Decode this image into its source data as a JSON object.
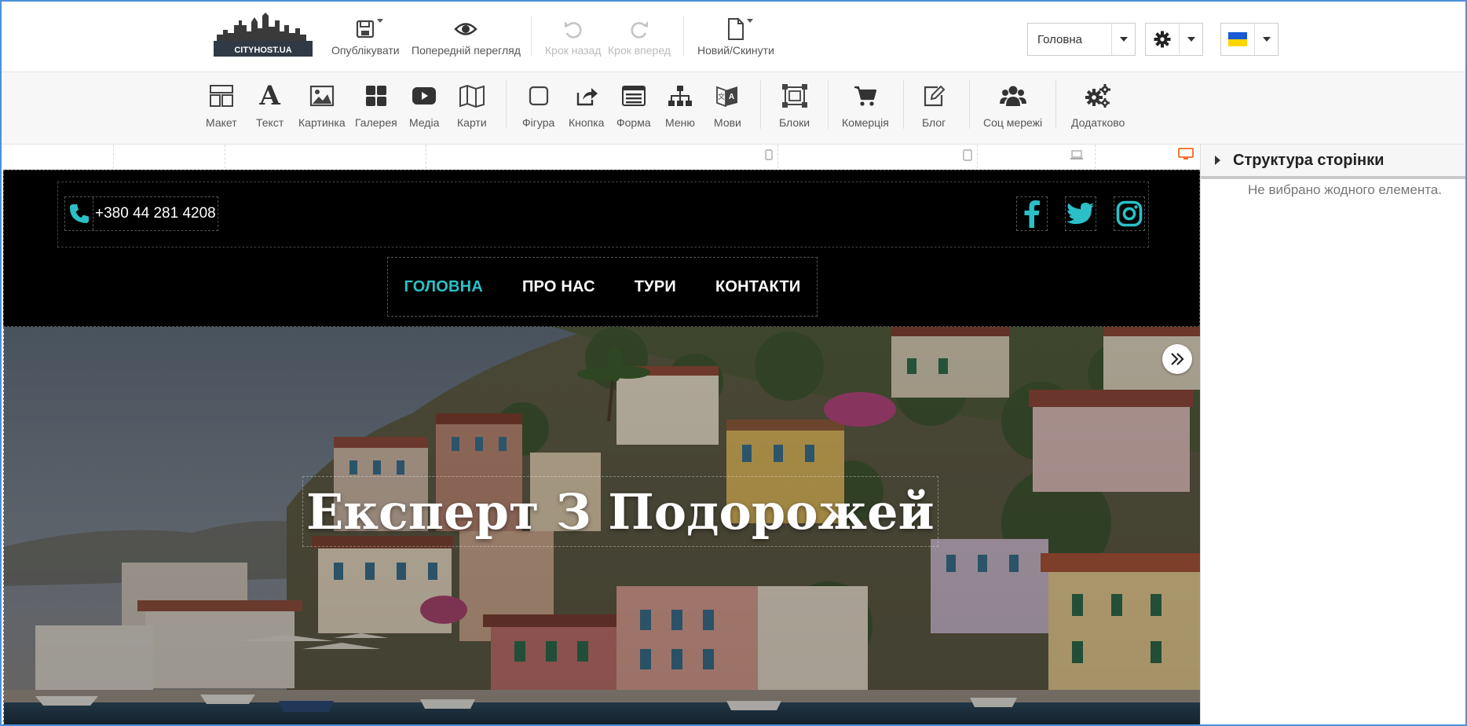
{
  "topbar": {
    "logo_text": "CITYHOST.UA",
    "publish": "Опублікувати",
    "preview": "Попередній перегляд",
    "undo": "Крок назад",
    "redo": "Крок вперед",
    "new_reset": "Новий/Скинути",
    "page_select": "Головна",
    "settings_icon": "gear-icon",
    "language_flag": "ukraine-flag",
    "colors": {
      "flag_top": "#1a5bd6",
      "flag_bottom": "#ffd500"
    }
  },
  "elements": {
    "items": [
      {
        "label": "Макет",
        "icon": "layout-icon"
      },
      {
        "label": "Текст",
        "icon": "text-icon"
      },
      {
        "label": "Картинка",
        "icon": "image-icon"
      },
      {
        "label": "Галерея",
        "icon": "gallery-icon"
      },
      {
        "label": "Медіа",
        "icon": "media-icon"
      },
      {
        "label": "Карти",
        "icon": "map-icon"
      },
      {
        "label": "Фігура",
        "icon": "shape-icon"
      },
      {
        "label": "Кнопка",
        "icon": "button-icon"
      },
      {
        "label": "Форма",
        "icon": "form-icon"
      },
      {
        "label": "Меню",
        "icon": "menu-icon"
      },
      {
        "label": "Мови",
        "icon": "languages-icon"
      },
      {
        "label": "Блоки",
        "icon": "blocks-icon"
      },
      {
        "label": "Комерція",
        "icon": "cart-icon"
      },
      {
        "label": "Блог",
        "icon": "blog-icon"
      },
      {
        "label": "Соц мережі",
        "icon": "social-icon"
      },
      {
        "label": "Додатково",
        "icon": "extra-icon"
      }
    ]
  },
  "site": {
    "phone": "+380 44 281 4208",
    "nav": [
      "ГОЛОВНА",
      "ПРО НАС",
      "ТУРИ",
      "КОНТАКТИ"
    ],
    "hero_title": "Експерт З Подорожей",
    "colors": {
      "accent": "#2bc0c8",
      "header_bg": "#000000",
      "device_active": "#f26a21"
    }
  },
  "panel": {
    "title": "Структура сторінки",
    "empty_text": "Не вибрано жодного елемента."
  }
}
